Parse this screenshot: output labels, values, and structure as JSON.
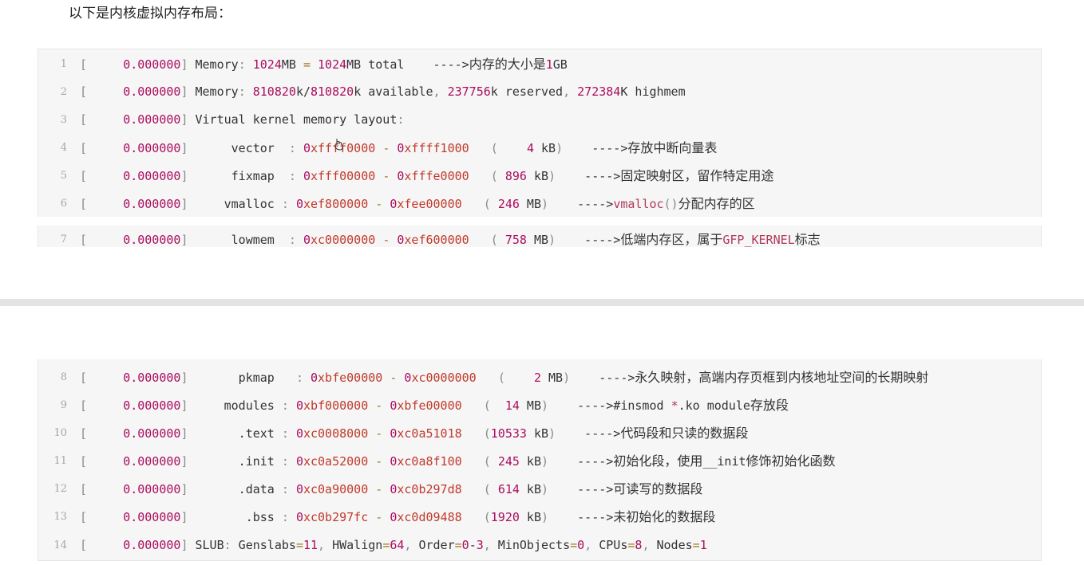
{
  "intro": "以下是内核虚拟内存布局：",
  "lines": [
    {
      "n": "1",
      "ts": "0.000000",
      "body": "Memory: 1024MB = 1024MB total    ---->内存的大小是1GB"
    },
    {
      "n": "2",
      "ts": "0.000000",
      "body": "Memory: 810820k/810820k available, 237756k reserved, 272384K highmem"
    },
    {
      "n": "3",
      "ts": "0.000000",
      "body": "Virtual kernel memory layout:"
    },
    {
      "n": "4",
      "ts": "0.000000",
      "name": "vector",
      "pad": "  ",
      "start": "0xffff0000",
      "end": "0xffff1000",
      "size": "(    4 kB)",
      "note": "存放中断向量表"
    },
    {
      "n": "5",
      "ts": "0.000000",
      "name": "fixmap",
      "pad": "  ",
      "start": "0xfff00000",
      "end": "0xfffe0000",
      "size": "( 896 kB)",
      "note": "固定映射区，留作特定用途"
    },
    {
      "n": "6",
      "ts": "0.000000",
      "name": "vmalloc",
      "pad": " ",
      "start": "0xef800000",
      "end": "0xfee00000",
      "size": "( 246 MB)",
      "note_fn": "vmalloc",
      "note_paren": "()",
      "note": "分配内存的区"
    },
    {
      "n": "7",
      "ts": "0.000000",
      "name": "lowmem",
      "pad": "  ",
      "start": "0xc0000000",
      "end": "0xef600000",
      "size": "( 758 MB)",
      "note": "低端内存区，属于",
      "note_tail": "GFP_KERNEL",
      "note_end": "标志"
    },
    {
      "n": "8",
      "ts": "0.000000",
      "name": "pkmap",
      "pad": "   ",
      "start": "0xbfe00000",
      "end": "0xc0000000",
      "size": "(    2 MB)",
      "note": "永久映射，高端内存页框到内核地址空间的长期映射"
    },
    {
      "n": "9",
      "ts": "0.000000",
      "name": "modules",
      "pad": " ",
      "start": "0xbf000000",
      "end": "0xbfe00000",
      "size": "(  14 MB)",
      "note": "#insmod *.ko module存放段"
    },
    {
      "n": "10",
      "ts": "0.000000",
      "name": "  .text",
      "pad": " ",
      "start": "0xc0008000",
      "end": "0xc0a51018",
      "size": "(10533 kB)",
      "note": "代码段和只读的数据段"
    },
    {
      "n": "11",
      "ts": "0.000000",
      "name": "  .init",
      "pad": " ",
      "start": "0xc0a52000",
      "end": "0xc0a8f100",
      "size": "( 245 kB)",
      "note": "初始化段，使用__init修饰初始化函数"
    },
    {
      "n": "12",
      "ts": "0.000000",
      "name": "  .data",
      "pad": " ",
      "start": "0xc0a90000",
      "end": "0xc0b297d8",
      "size": "( 614 kB)",
      "note": "可读写的数据段"
    },
    {
      "n": "13",
      "ts": "0.000000",
      "name": "   .bss",
      "pad": " ",
      "start": "0xc0b297fc",
      "end": "0xc0d09488",
      "size": "(1920 kB)",
      "note": "未初始化的数据段"
    },
    {
      "n": "14",
      "ts": "0.000000",
      "body": "SLUB: Genslabs=11, HWalign=64, Order=0-3, MinObjects=0, CPUs=8, Nodes=1"
    }
  ],
  "arrow": "---->",
  "colors": {
    "number": "#aa0d5f",
    "hex": "#c0392b",
    "lineno": "#a6a6a6",
    "code_bg": "#f6f6f6"
  }
}
